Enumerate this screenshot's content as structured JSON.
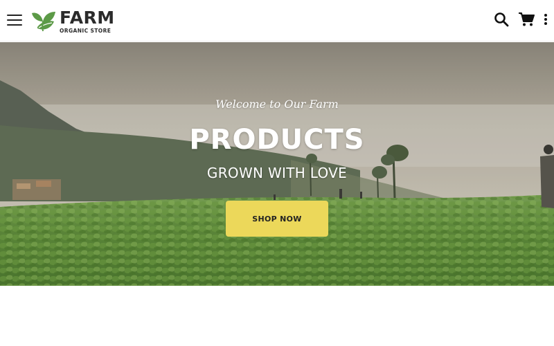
{
  "header": {
    "menu_icon": "hamburger-icon",
    "logo": {
      "title": "FARM",
      "subtitle": "ORGANIC STORE",
      "icon": "leaf-icon",
      "leaf_color": "#5c9a47"
    },
    "actions": [
      {
        "name": "search-icon"
      },
      {
        "name": "cart-icon"
      },
      {
        "name": "more-vertical-icon"
      }
    ]
  },
  "hero": {
    "eyebrow": "Welcome to Our Farm",
    "title": "PRODUCTS",
    "subtitle": "GROWN WITH LOVE",
    "cta_label": "SHOP NOW",
    "cta_color": "#ecd85a"
  }
}
